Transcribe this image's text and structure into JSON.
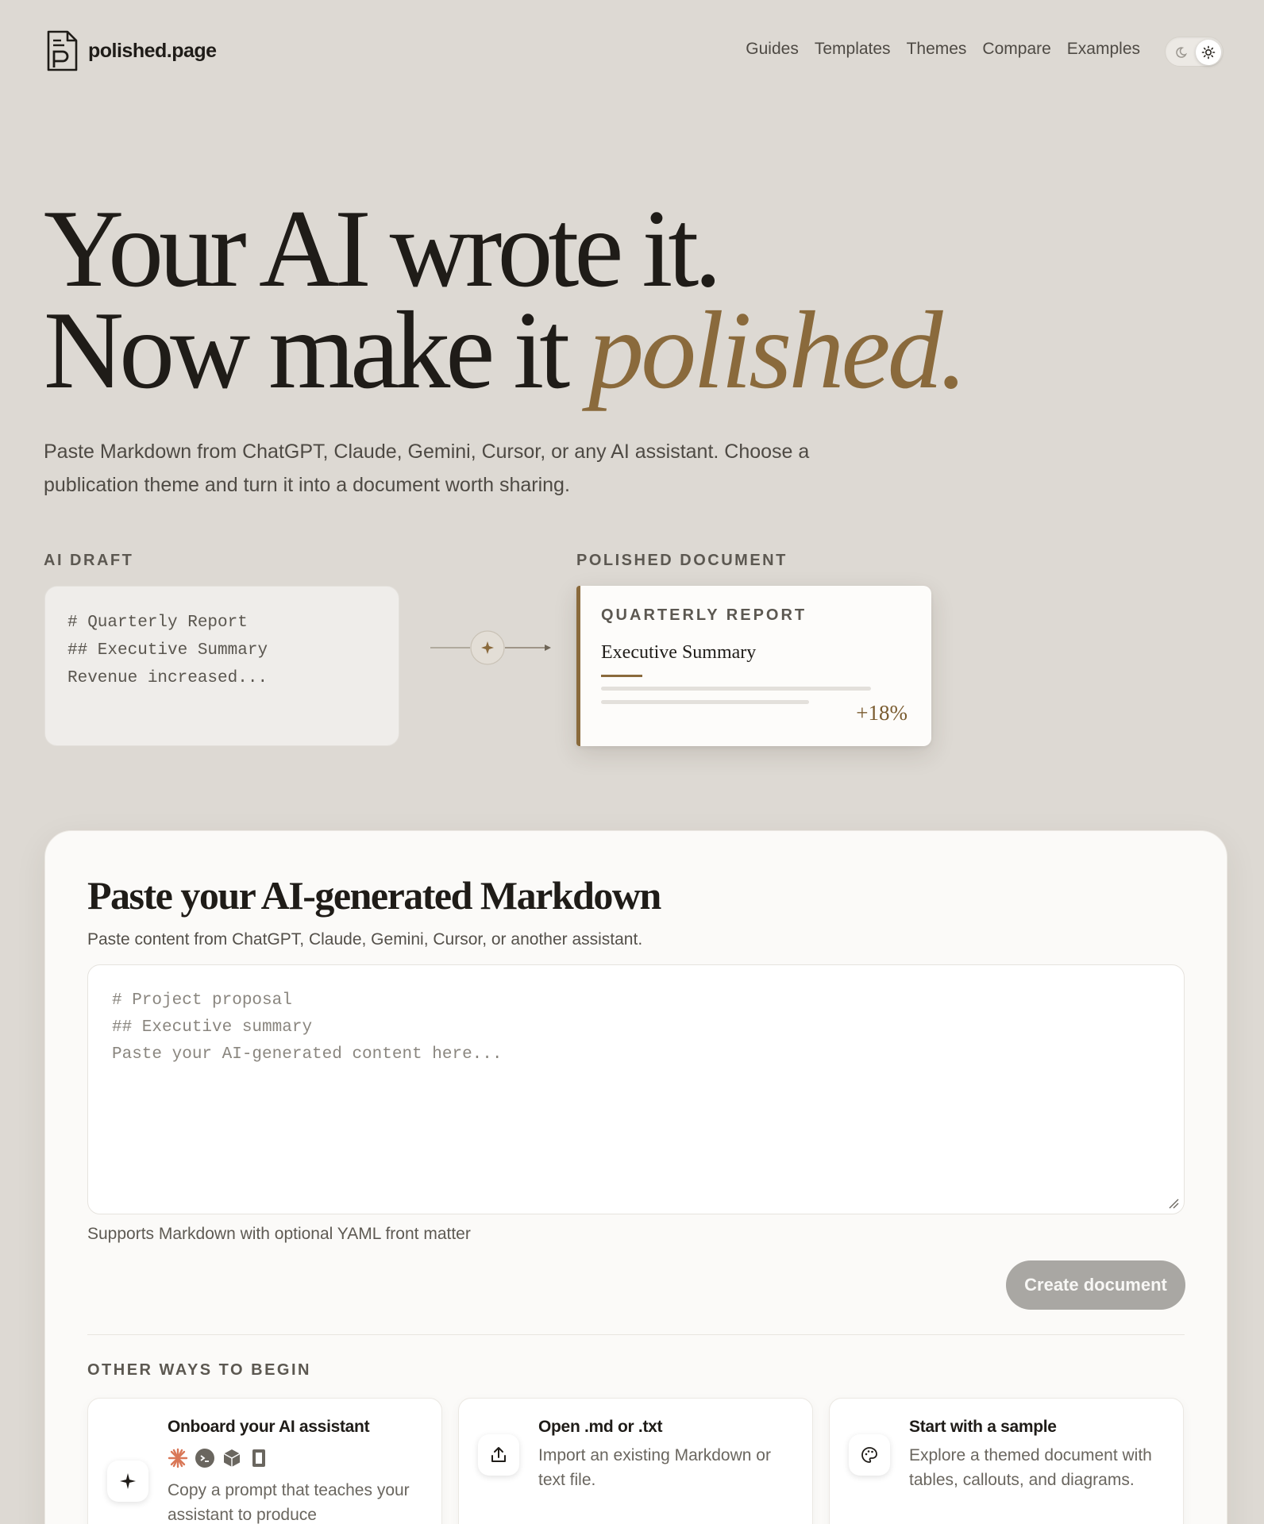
{
  "header": {
    "brand": "polished.page",
    "nav": [
      "Guides",
      "Templates",
      "Themes",
      "Compare",
      "Examples"
    ],
    "theme_toggle": {
      "current": "light"
    }
  },
  "hero": {
    "line1": "Your AI wrote it.",
    "line2_prefix": "Now make it ",
    "line2_accent": "polished.",
    "subtitle": "Paste Markdown from ChatGPT, Claude, Gemini, Cursor, or any AI assistant. Choose a publication theme and turn it into a document worth sharing."
  },
  "comparison": {
    "draft_label": "AI DRAFT",
    "draft_lines": [
      "# Quarterly Report",
      "## Executive Summary",
      "Revenue increased..."
    ],
    "doc_label": "POLISHED DOCUMENT",
    "doc_kicker": "QUARTERLY REPORT",
    "doc_heading": "Executive Summary",
    "doc_stat": "+18%"
  },
  "editor": {
    "title": "Paste your AI-generated Markdown",
    "subtitle": "Paste content from ChatGPT, Claude, Gemini, Cursor, or another assistant.",
    "placeholder_lines": [
      "# Project proposal",
      "## Executive summary",
      "Paste your AI-generated content here..."
    ],
    "hint": "Supports Markdown with optional YAML front matter",
    "create_button": "Create document"
  },
  "other_ways": {
    "label": "OTHER WAYS TO BEGIN",
    "cards": [
      {
        "title": "Onboard your AI assistant",
        "desc": "Copy a prompt that teaches your assistant to produce",
        "icon": "sparkle-icon"
      },
      {
        "title": "Open .md or .txt",
        "desc": "Import an existing Markdown or text file.",
        "icon": "upload-icon"
      },
      {
        "title": "Start with a sample",
        "desc": "Explore a themed document with tables, callouts, and diagrams.",
        "icon": "palette-icon"
      }
    ]
  },
  "colors": {
    "background": "#ddd9d3",
    "accent": "#8a6a3c",
    "text": "#1f1c18"
  }
}
